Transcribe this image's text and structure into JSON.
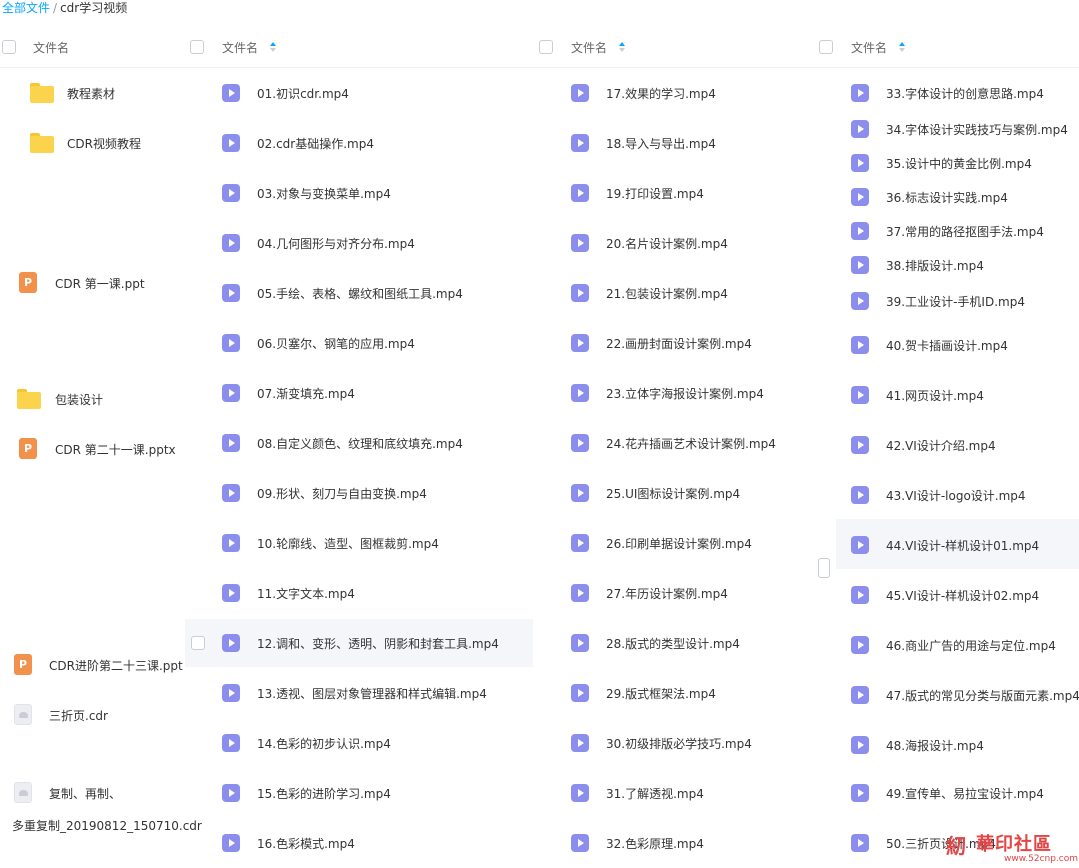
{
  "breadcrumb": {
    "root": "全部文件",
    "separator": "/",
    "current": "cdr学习视频"
  },
  "header_label": "文件名",
  "colors": {
    "accent": "#06a7ff",
    "video_icon": "#8c8eee",
    "folder": "#fcd34d",
    "ppt": "#f2914b"
  },
  "col1": [
    {
      "type": "folder",
      "name": "教程素材"
    },
    {
      "type": "folder",
      "name": "CDR视频教程"
    },
    {
      "type": "ppt",
      "name": "CDR 第一课.ppt"
    },
    {
      "type": "folder",
      "name": "包装设计"
    },
    {
      "type": "ppt",
      "name": "CDR 第二十一课.pptx"
    },
    {
      "type": "ppt",
      "name": "CDR进阶第二十三课.ppt"
    },
    {
      "type": "cdr",
      "name": "三折页.cdr"
    },
    {
      "type": "cdr",
      "name": "复制、再制、"
    },
    {
      "type": "text",
      "name": "多重复制_20190812_150710.cdr"
    }
  ],
  "col2": [
    "01.初识cdr.mp4",
    "02.cdr基础操作.mp4",
    "03.对象与变换菜单.mp4",
    "04.几何图形与对齐分布.mp4",
    "05.手绘、表格、螺纹和图纸工具.mp4",
    "06.贝塞尔、钢笔的应用.mp4",
    "07.渐变填充.mp4",
    "08.自定义颜色、纹理和底纹填充.mp4",
    "09.形状、刻刀与自由变换.mp4",
    "10.轮廓线、造型、图框裁剪.mp4",
    "11.文字文本.mp4",
    "12.调和、变形、透明、阴影和封套工具.mp4",
    "13.透视、图层对象管理器和样式编辑.mp4",
    "14.色彩的初步认识.mp4",
    "15.色彩的进阶学习.mp4",
    "16.色彩模式.mp4"
  ],
  "col3": [
    "17.效果的学习.mp4",
    "18.导入与导出.mp4",
    "19.打印设置.mp4",
    "20.名片设计案例.mp4",
    "21.包装设计案例.mp4",
    "22.画册封面设计案例.mp4",
    "23.立体字海报设计案例.mp4",
    "24.花卉插画艺术设计案例.mp4",
    "25.UI图标设计案例.mp4",
    "26.印刷单据设计案例.mp4",
    "27.年历设计案例.mp4",
    "28.版式的类型设计.mp4",
    "29.版式框架法.mp4",
    "30.初级排版必学技巧.mp4",
    "31.了解透视.mp4",
    "32.色彩原理.mp4"
  ],
  "col4": [
    "33.字体设计的创意思路.mp4",
    "34.字体设计实践技巧与案例.mp4",
    "35.设计中的黄金比例.mp4",
    "36.标志设计实践.mp4",
    "37.常用的路径抠图手法.mp4",
    "38.排版设计.mp4",
    "39.工业设计-手机ID.mp4",
    "40.贺卡插画设计.mp4",
    "41.网页设计.mp4",
    "42.VI设计介绍.mp4",
    "43.VI设计-logo设计.mp4",
    "44.VI设计-样机设计01.mp4",
    "45.VI设计-样机设计02.mp4",
    "46.商业广告的用途与定位.mp4",
    "47.版式的常见分类与版面元素.mp4",
    "48.海报设计.mp4",
    "49.宣传单、易拉宝设计.mp4",
    "50.三折页设计.mp4"
  ],
  "watermark": {
    "logo": "糿",
    "title": "華印社區",
    "url": "www.52cnp.com"
  }
}
